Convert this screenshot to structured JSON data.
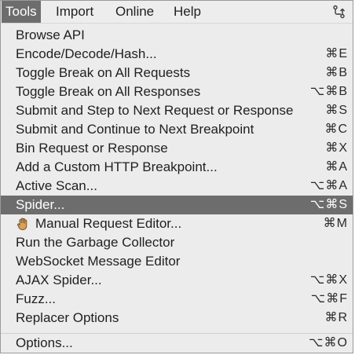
{
  "menubar": {
    "items": [
      {
        "label": "Tools"
      },
      {
        "label": "Import"
      },
      {
        "label": "Online"
      },
      {
        "label": "Help"
      }
    ],
    "tray_icon": "branch-fork-icon"
  },
  "menu": {
    "items": [
      {
        "label": "Browse API",
        "shortcut": ""
      },
      {
        "label": "Encode/Decode/Hash...",
        "shortcut": "⌘E"
      },
      {
        "label": "Toggle Break on All Requests",
        "shortcut": "⌘B"
      },
      {
        "label": "Toggle Break on All Responses",
        "shortcut": "⌥⌘B"
      },
      {
        "label": "Submit and Step to Next Request or Response",
        "shortcut": "⌘S"
      },
      {
        "label": "Submit and Continue to Next Breakpoint",
        "shortcut": "⌘C"
      },
      {
        "label": "Bin Request or Response",
        "shortcut": "⌘X"
      },
      {
        "label": "Add a Custom HTTP Breakpoint...",
        "shortcut": "⌘A"
      },
      {
        "label": "Active Scan...",
        "shortcut": "⌥⌘A"
      },
      {
        "label": "Spider...",
        "shortcut": "⌥⌘S"
      },
      {
        "label": "Manual Request Editor...",
        "shortcut": "⌘M",
        "icon": "hand-icon"
      },
      {
        "label": "Run the Garbage Collector",
        "shortcut": ""
      },
      {
        "label": "WebSocket Message Editor",
        "shortcut": ""
      },
      {
        "label": "AJAX Spider...",
        "shortcut": "⌥⌘X"
      },
      {
        "label": "Fuzz...",
        "shortcut": "⌥⌘F"
      },
      {
        "label": "Replacer Options",
        "shortcut": "⌘R"
      },
      {
        "label": "Options...",
        "shortcut": "⌥⌘O"
      }
    ]
  },
  "colors": {
    "menubar_bg": "#ededed",
    "menu_bg": "#ececec",
    "highlight": "#6d6d6d",
    "text": "#1f1f1f"
  }
}
